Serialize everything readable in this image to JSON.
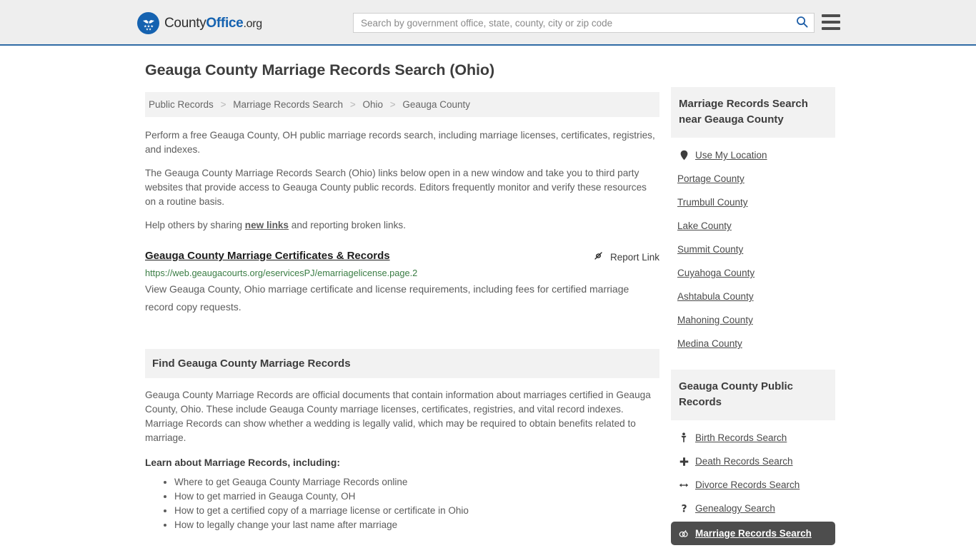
{
  "header": {
    "logo": {
      "part1": "County",
      "part2": "Office",
      "part3": ".org",
      "icon": "eagle-emblem-icon"
    },
    "search": {
      "placeholder": "Search by government office, state, county, city or zip code",
      "value": "",
      "search_icon": "search-icon"
    },
    "menu_icon": "hamburger-menu-icon",
    "accent_color": "#1562b0",
    "border_color": "#2f6ba5"
  },
  "main": {
    "title": "Geauga County Marriage Records Search (Ohio)",
    "breadcrumb": {
      "items": [
        "Public Records",
        "Marriage Records Search",
        "Ohio",
        "Geauga County"
      ],
      "separator": ">"
    },
    "intro": {
      "p1": "Perform a free Geauga County, OH public marriage records search, including marriage licenses, certificates, registries, and indexes.",
      "p2": "The Geauga County Marriage Records Search (Ohio) links below open in a new window and take you to third party websites that provide access to Geauga County public records. Editors frequently monitor and verify these resources on a routine basis.",
      "p3_before": "Help others by sharing ",
      "p3_link": "new links",
      "p3_after": " and reporting broken links."
    },
    "result": {
      "title": "Geauga County Marriage Certificates & Records",
      "url": "https://web.geaugacourts.org/eservicesPJ/emarriagelicense.page.2",
      "description": "View Geauga County, Ohio marriage certificate and license requirements, including fees for certified marriage record copy requests.",
      "report_label": "Report Link",
      "report_icon": "broken-link-icon",
      "url_color": "#3a7d44"
    },
    "find_section": {
      "heading": "Find Geauga County Marriage Records",
      "body": "Geauga County Marriage Records are official documents that contain information about marriages certified in Geauga County, Ohio. These include Geauga County marriage licenses, certificates, registries, and vital record indexes. Marriage Records can show whether a wedding is legally valid, which may be required to obtain benefits related to marriage.",
      "learn_heading": "Learn about Marriage Records, including:",
      "learn_items": [
        "Where to get Geauga County Marriage Records online",
        "How to get married in Geauga County, OH",
        "How to get a certified copy of a marriage license or certificate in Ohio",
        "How to legally change your last name after marriage"
      ]
    }
  },
  "sidebar": {
    "nearby": {
      "heading": "Marriage Records Search near Geauga County",
      "items": [
        {
          "label": "Use My Location",
          "icon": "map-pin-icon"
        },
        {
          "label": "Portage County",
          "icon": ""
        },
        {
          "label": "Trumbull County",
          "icon": ""
        },
        {
          "label": "Lake County",
          "icon": ""
        },
        {
          "label": "Summit County",
          "icon": ""
        },
        {
          "label": "Cuyahoga County",
          "icon": ""
        },
        {
          "label": "Ashtabula County",
          "icon": ""
        },
        {
          "label": "Mahoning County",
          "icon": ""
        },
        {
          "label": "Medina County",
          "icon": ""
        }
      ]
    },
    "public_records": {
      "heading": "Geauga County Public Records",
      "items": [
        {
          "label": "Birth Records Search",
          "icon": "baby-icon",
          "glyph": "Ɣ",
          "active": false
        },
        {
          "label": "Death Records Search",
          "icon": "cross-icon",
          "glyph": "✚",
          "active": false
        },
        {
          "label": "Divorce Records Search",
          "icon": "left-right-arrow-icon",
          "glyph": "↔",
          "active": false
        },
        {
          "label": "Genealogy Search",
          "icon": "question-mark-icon",
          "glyph": "?",
          "active": false
        },
        {
          "label": "Marriage Records Search",
          "icon": "wedding-rings-icon",
          "glyph": "⚭",
          "active": true
        }
      ],
      "active_bg": "#4d4d4d"
    }
  }
}
